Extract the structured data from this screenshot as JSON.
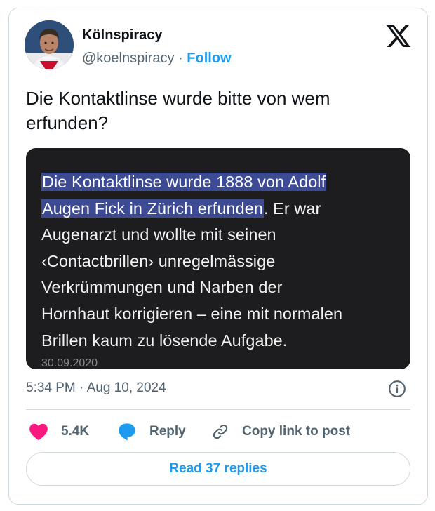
{
  "author": {
    "display_name": "Kölnspiracy",
    "handle": "@koelnspiracy",
    "separator": "·",
    "follow_label": "Follow"
  },
  "tweet": {
    "text": "Die Kontaktlinse wurde bitte von wem erfunden?"
  },
  "media": {
    "highlight_line1": "Die Kontaktlinse wurde 1888 von Adolf",
    "highlight_line2": "Augen Fick in Zürich erfunden",
    "rest_line2": ". Er war",
    "line3": "Augenarzt und wollte mit seinen",
    "line4": "‹Contactbrillen› unregelmässige",
    "line5": "Verkrümmungen und Narben der",
    "line6": "Hornhaut korrigieren – eine mit normalen",
    "line7": "Brillen kaum zu lösende Aufgabe.",
    "date": "30.09.2020"
  },
  "meta": {
    "timestamp": "5:34 PM · Aug 10, 2024"
  },
  "actions": {
    "like_count": "5.4K",
    "reply_label": "Reply",
    "copy_label": "Copy link to post"
  },
  "read_replies_label": "Read 37 replies",
  "colors": {
    "accent": "#1d9bf0",
    "like": "#f91880",
    "highlight": "#3d4a94",
    "media_bg": "#1d1d1f"
  },
  "icons": [
    "x-logo-icon",
    "info-icon",
    "heart-icon",
    "reply-bubble-icon",
    "link-icon"
  ]
}
